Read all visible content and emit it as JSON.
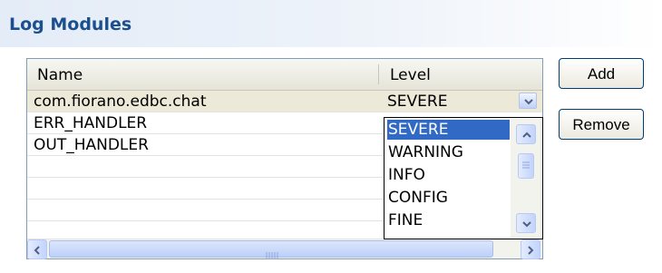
{
  "section": {
    "title": "Log Modules"
  },
  "table": {
    "columns": [
      "Name",
      "Level"
    ],
    "rows": [
      {
        "name": "com.fiorano.edbc.chat",
        "level": "SEVERE"
      },
      {
        "name": "ERR_HANDLER",
        "level": ""
      },
      {
        "name": "OUT_HANDLER",
        "level": ""
      }
    ]
  },
  "dropdown": {
    "selected": "SEVERE",
    "options": [
      "SEVERE",
      "WARNING",
      "INFO",
      "CONFIG",
      "FINE"
    ]
  },
  "buttons": {
    "add": "Add",
    "remove": "Remove"
  },
  "scrollbars": {
    "hthumb_grip": "IIIII"
  },
  "colors": {
    "header_text": "#1b4f8e",
    "selection": "#316ac5",
    "border": "#7f9db9"
  },
  "icons": [
    "chevron-down-icon",
    "chevron-up-icon",
    "chevron-left-icon",
    "chevron-right-icon",
    "grip-icon"
  ]
}
